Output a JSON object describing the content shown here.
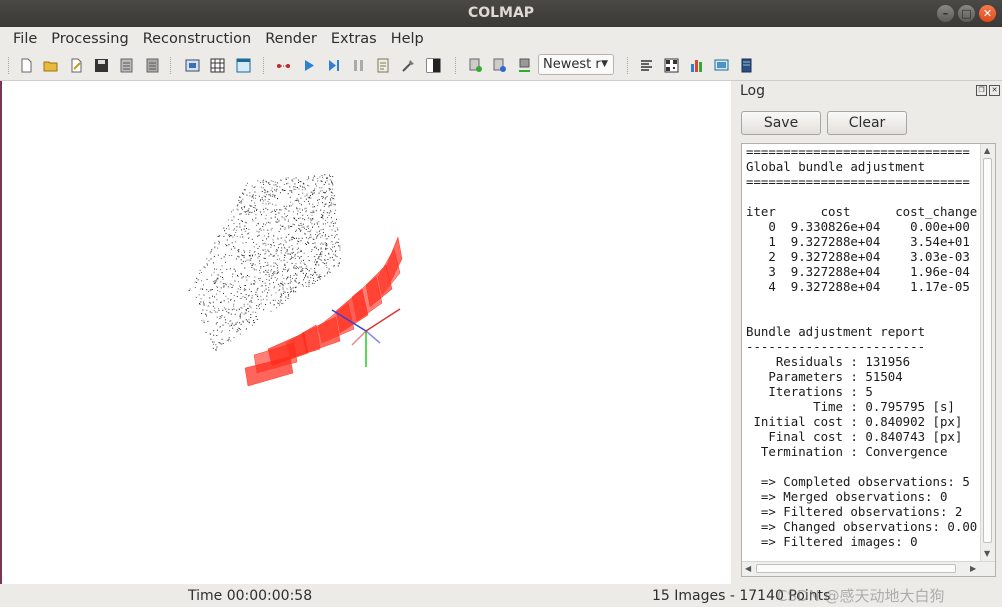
{
  "window": {
    "title": "COLMAP"
  },
  "menu": [
    "File",
    "Processing",
    "Reconstruction",
    "Render",
    "Extras",
    "Help"
  ],
  "toolbar": {
    "combo_value": "Newest r",
    "icons": [
      "new-project-icon",
      "open-project-icon",
      "edit-project-icon",
      "save-project-icon",
      "import-model-icon",
      "export-model-icon",
      "import-image-icon",
      "grid-icon",
      "view-panel-icon",
      "feature-extraction-icon",
      "play-icon",
      "step-play-icon",
      "pause-icon",
      "report-icon",
      "tools-icon",
      "contrast-icon",
      "add-images-icon",
      "database-icon",
      "export-icon",
      "align-icon",
      "qr-icon",
      "chart-icon",
      "screenshot-icon",
      "book-icon"
    ]
  },
  "log": {
    "title": "Log",
    "save_label": "Save",
    "clear_label": "Clear",
    "lines": [
      "==============================",
      "Global bundle adjustment",
      "==============================",
      "",
      "iter      cost      cost_change",
      "   0  9.330826e+04    0.00e+00",
      "   1  9.327288e+04    3.54e+01",
      "   2  9.327288e+04    3.03e-03",
      "   3  9.327288e+04    1.96e-04",
      "   4  9.327288e+04    1.17e-05",
      "",
      "",
      "Bundle adjustment report",
      "------------------------",
      "    Residuals : 131956",
      "   Parameters : 51504",
      "   Iterations : 5",
      "         Time : 0.795795 [s]",
      " Initial cost : 0.840902 [px]",
      "   Final cost : 0.840743 [px]",
      "  Termination : Convergence",
      "",
      "  => Completed observations: 5",
      "  => Merged observations: 0",
      "  => Filtered observations: 2",
      "  => Changed observations: 0.00",
      "  => Filtered images: 0"
    ]
  },
  "status": {
    "time": "Time 00:00:00:58",
    "counts": "15 Images - 17140 Points"
  },
  "watermark": "CSDN @感天动地大白狗",
  "colors": {
    "camera_red": "#ff2a1a",
    "axis_blue": "#3344dd",
    "axis_green": "#22cc22",
    "axis_red": "#dd3333"
  }
}
